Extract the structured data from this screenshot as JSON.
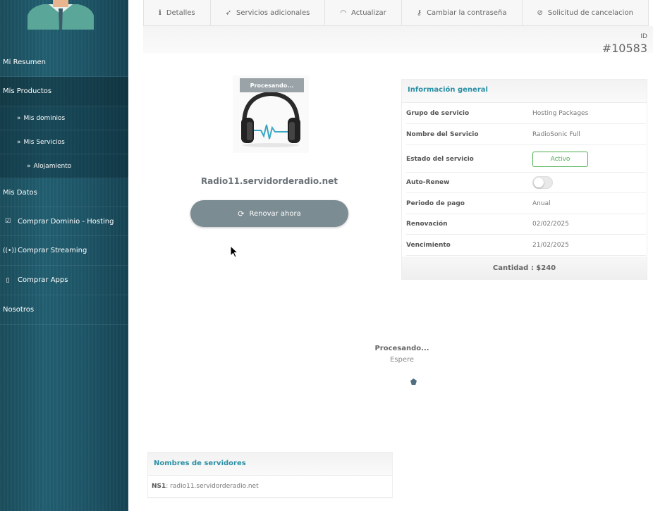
{
  "sidebar": {
    "items": [
      {
        "label": "Mi Resumen",
        "icon": ""
      },
      {
        "label": "Mis Productos",
        "icon": ""
      },
      {
        "label": "Mis dominios",
        "icon": "double-chevron-right-icon"
      },
      {
        "label": "Mis Servicios",
        "icon": "double-chevron-right-icon"
      },
      {
        "label": "Alojamiento",
        "icon": "double-chevron-right-icon"
      },
      {
        "label": "Mis Datos",
        "icon": ""
      },
      {
        "label": "Comprar Dominio - Hosting",
        "icon": "checkbox-icon"
      },
      {
        "label": "Comprar Streaming",
        "icon": "broadcast-icon"
      },
      {
        "label": "Comprar Apps",
        "icon": "mobile-icon"
      },
      {
        "label": "Nosotros",
        "icon": ""
      }
    ]
  },
  "tabs": [
    {
      "label": "Detalles",
      "icon": "info-icon"
    },
    {
      "label": "Servicios adicionales",
      "icon": "rocket-icon"
    },
    {
      "label": "Actualizar",
      "icon": "gauge-icon"
    },
    {
      "label": "Cambiar la contraseña",
      "icon": "key-icon"
    },
    {
      "label": "Solicitud de cancelacion",
      "icon": "ban-icon"
    }
  ],
  "service_id": {
    "label": "ID",
    "value": "#10583"
  },
  "product": {
    "processing_badge": "Procesando...",
    "domain": "Radio11.servidorderadio.net",
    "renew_label": "Renovar ahora"
  },
  "info": {
    "title": "Información general",
    "rows": [
      {
        "key": "Grupo de servicio",
        "value": "Hosting Packages"
      },
      {
        "key": "Nombre del Servicio",
        "value": "RadioSonic Full"
      },
      {
        "key": "Estado del servicio",
        "value": "Activo"
      },
      {
        "key": "Auto-Renew",
        "value": ""
      },
      {
        "key": "Periodo de pago",
        "value": "Anual"
      },
      {
        "key": "Renovación",
        "value": "02/02/2025"
      },
      {
        "key": "Vencimiento",
        "value": "21/02/2025"
      }
    ],
    "total": "Cantidad : $240"
  },
  "processing": {
    "title": "Procesando...",
    "subtitle": "Espere"
  },
  "nameservers": {
    "title": "Nombres de servidores",
    "ns1_label": "NS1",
    "ns1_value": ": radio11.servidorderadio.net"
  },
  "colors": {
    "accent": "#2a8fa4",
    "status_active": "#4caf50",
    "sidebar": "#1d5466",
    "button": "#7c8c93"
  }
}
